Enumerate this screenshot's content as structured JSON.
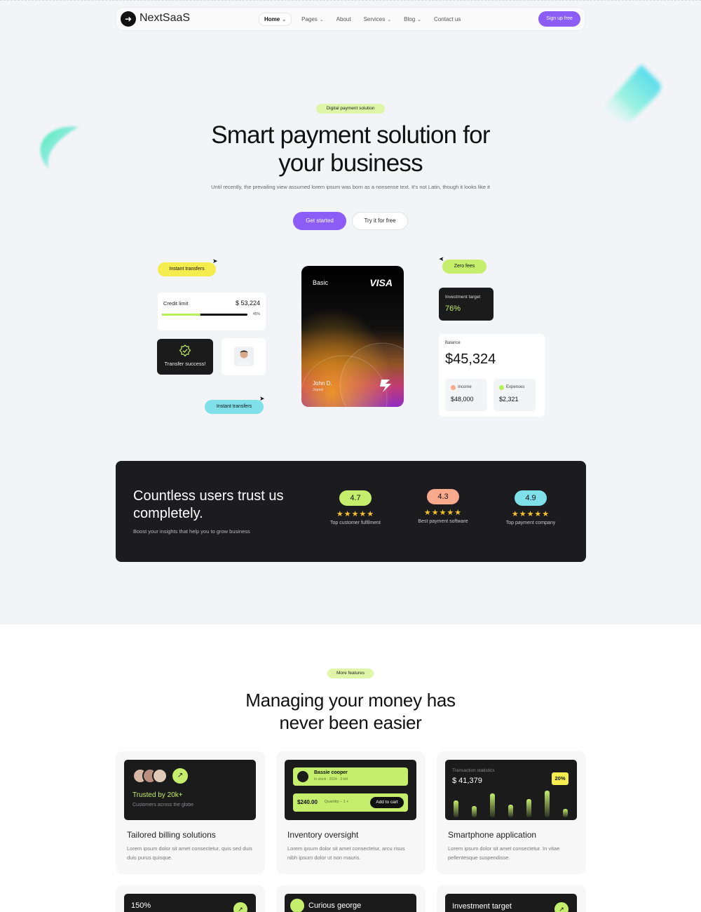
{
  "nav": {
    "logo_text": "NextSaaS",
    "logo_icon": "arrow-right-icon",
    "links": [
      {
        "label": "Home",
        "dropdown": true
      },
      {
        "label": "Pages",
        "dropdown": true
      },
      {
        "label": "About",
        "dropdown": false
      },
      {
        "label": "Services",
        "dropdown": true
      },
      {
        "label": "Blog",
        "dropdown": true
      },
      {
        "label": "Contact us",
        "dropdown": false
      }
    ],
    "signup_label": "Sign up free"
  },
  "hero": {
    "badge": "Digital payment solution",
    "title_line1": "Smart  payment solution for",
    "title_line2": "your business",
    "subtitle": "Until recently, the prevailing view assumed lorem ipsum was born as a nonsense text. It's not Latin, though it looks like it",
    "primary_cta": "Get started",
    "secondary_cta": "Try it for free"
  },
  "widgets": {
    "tag_instant_1": "Instant transfers",
    "tag_instant_2": "Instant transfers",
    "tag_zero_fees": "Zero fees",
    "credit_limit": {
      "label": "Credit limit",
      "value": "$ 53,224",
      "percent_label": "45%",
      "fill": 0.45
    },
    "transfer": {
      "label": "Transfer success!"
    },
    "card": {
      "tier": "Basic",
      "brand": "VISA",
      "holder": "John D.",
      "holder_sub": "Joyed"
    },
    "investment": {
      "label": "Investment target",
      "value": "76%"
    },
    "balance": {
      "label": "Balance",
      "value": "$45,324",
      "income_label": "Income",
      "income_value": "$48,000",
      "expenses_label": "Expenses",
      "expenses_value": "$2,321"
    }
  },
  "trust": {
    "title": "Countless users trust us completely.",
    "subtitle": "Boost your insights that help you to grow business",
    "ratings": [
      {
        "score": "4.7",
        "stars": "★★★★★",
        "label": "Top customer fulfilment",
        "color": "#c4ee6c"
      },
      {
        "score": "4.3",
        "stars": "★★★★★",
        "label": "Best payment software",
        "color": "#f9a98c"
      },
      {
        "score": "4.9",
        "stars": "★★★★★",
        "label": "Top payment company",
        "color": "#7fe0ea"
      }
    ]
  },
  "features": {
    "badge": "More features",
    "title_line1": "Managing your money has",
    "title_line2": "never been easier",
    "cards": [
      {
        "title": "Tailored billing solutions",
        "desc": "Lorem ipsum dolor sit amet consectetur, quis sed duis duis purus quisque.",
        "trusted": "Trusted by 20k+",
        "trusted_sub": "Customers across the globe"
      },
      {
        "title": "Inventory oversight",
        "desc": "Lorem ipsum dolor sit amet consectetur, arcu risus nibh ipsum dolor ut non mauris.",
        "item_name": "Bassie cooper",
        "item_meta": "In stock · 2024 · 3 left",
        "price": "$240.00",
        "qty": "Quantity  –  1  +",
        "cart": "Add to cart"
      },
      {
        "title": "Smartphone application",
        "desc": "Lorem ipsum dolor sit amet consectetur. In vitae pellentesque suspendisse.",
        "stat_label": "Transaction statistics",
        "stat_value": "$ 41,379",
        "badge": "20%"
      }
    ],
    "row2": [
      {
        "text": "150%"
      },
      {
        "text": "Curious george"
      },
      {
        "text": "Investment target"
      }
    ]
  },
  "colors": {
    "accent": "#8b5cf6",
    "lime": "#c4ee6c",
    "yellow": "#f5ec4e",
    "cyan": "#7fe0ea",
    "dark": "#1b1b1b"
  }
}
